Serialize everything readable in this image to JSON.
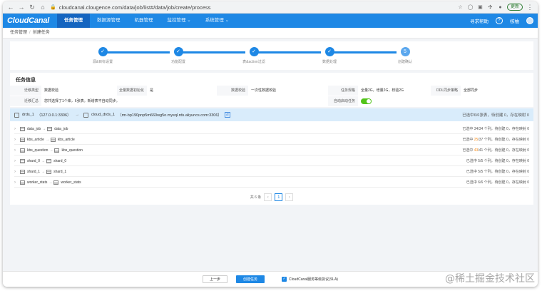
{
  "browser": {
    "url": "cloudcanal.clougence.com/data/job/list#/data/job/create/process",
    "update_label": "更新"
  },
  "app": {
    "logo": "CloudCanal",
    "menu": [
      "任务管理",
      "数据源管理",
      "机器管理",
      "监控管理",
      "系统管理"
    ],
    "help_label": "寻求帮助",
    "user_label": "核柚"
  },
  "breadcrumb": [
    "任务管理",
    "创建任务"
  ],
  "steps": [
    {
      "num": "✓",
      "label": "源&目标设置"
    },
    {
      "num": "✓",
      "label": "功能配置"
    },
    {
      "num": "✓",
      "label": "表&action过滤"
    },
    {
      "num": "✓",
      "label": "数据处理"
    },
    {
      "num": "5",
      "label": "创建确认"
    }
  ],
  "task_info": {
    "title": "任务信息",
    "row1": [
      {
        "label": "迁移类型",
        "value": "数据校验"
      },
      {
        "label": "全量数据初始化",
        "value": "是"
      },
      {
        "label": "数据校验",
        "value": "一次性数据校验"
      },
      {
        "label": "任务规格",
        "value": "全量2G，增量2G，校验2G"
      },
      {
        "label": "DDL同步策略",
        "value": "全部同步"
      }
    ],
    "row2": [
      {
        "label": "迁移汇总",
        "value": "您共选择了1个库，6张表。新增表不自动同步。"
      },
      {
        "label": "自动启动任务",
        "value": ""
      }
    ]
  },
  "mapping": {
    "source": "drds_1",
    "source_addr": "（127.0.0.1:3306）",
    "target": "cloud_drds_1",
    "target_addr": "（rm-bp190pnp5m660wg5o.mysql.rds.aliyuncs.com:3306）",
    "tag": "改",
    "head_stat": "已选中6/6张表，待创建 0，存在映射 0",
    "rows": [
      {
        "src": "data_job",
        "dst": "data_job",
        "stat_pre": "已选中 34/34 个列，待创建 0，存在映射 0",
        "highlight": ""
      },
      {
        "src": "kbs_article",
        "dst": "kbs_article",
        "stat_pre": "已选中 ",
        "highlight": "25",
        "stat_post": "/37 个列，待创建 0，存在映射 0"
      },
      {
        "src": "kbs_question",
        "dst": "kbs_question",
        "stat_pre": "已选中 ",
        "highlight": "43",
        "stat_post": "/41 个列，待创建 0，存在映射 0"
      },
      {
        "src": "shard_0",
        "dst": "shard_0",
        "stat_pre": "已选中 5/5 个列，待创建 0，存在映射 0",
        "highlight": ""
      },
      {
        "src": "shard_1",
        "dst": "shard_1",
        "stat_pre": "已选中 5/5 个列，待创建 0，存在映射 0",
        "highlight": ""
      },
      {
        "src": "worker_stats",
        "dst": "worker_stats",
        "stat_pre": "已选中 6/6 个列，待创建 0，存在映射 0",
        "highlight": ""
      }
    ],
    "total": "共 6 条",
    "page": "1"
  },
  "footer": {
    "prev_label": "上一步",
    "create_label": "创建任务",
    "sla_label": "CloudCanal服务等级协议(SLA)"
  },
  "watermark": "@稀土掘金技术社区",
  "colors": {
    "primary": "#1e88e5",
    "success": "#52c41a",
    "warning": "#fa8c16"
  }
}
